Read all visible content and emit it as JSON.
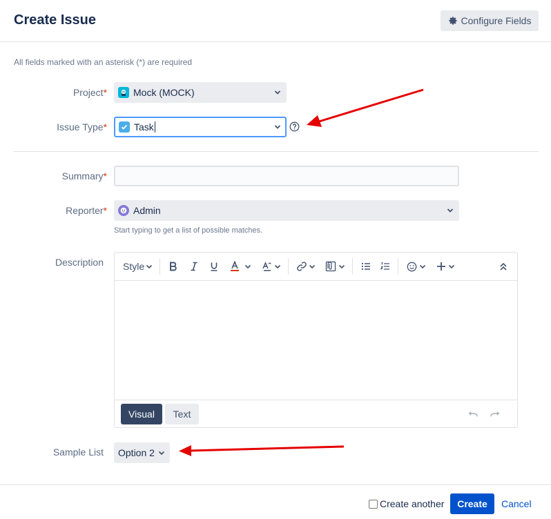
{
  "dialog": {
    "title": "Create Issue",
    "configure_label": "Configure Fields",
    "required_note": "All fields marked with an asterisk (*) are required"
  },
  "fields": {
    "project": {
      "label": "Project",
      "value": "Mock (MOCK)",
      "icon": "project-avatar-icon"
    },
    "issue_type": {
      "label": "Issue Type",
      "value": "Task",
      "icon": "task-checkbox-icon"
    },
    "summary": {
      "label": "Summary",
      "value": ""
    },
    "reporter": {
      "label": "Reporter",
      "value": "Admin",
      "hint": "Start typing to get a list of possible matches.",
      "icon": "user-avatar-icon"
    },
    "description": {
      "label": "Description"
    },
    "sample_list": {
      "label": "Sample List",
      "value": "Option 2"
    }
  },
  "required_marker": "*",
  "editor": {
    "style_label": "Style",
    "mode_visual": "Visual",
    "mode_text": "Text",
    "toolbar_icons": [
      "bold-icon",
      "italic-icon",
      "underline-icon",
      "text-color-icon",
      "text-format-icon",
      "link-icon",
      "attachment-icon",
      "bullet-list-icon",
      "numbered-list-icon",
      "emoji-icon",
      "insert-icon",
      "collapse-icon",
      "undo-icon",
      "redo-icon"
    ]
  },
  "footer": {
    "create_another_label": "Create another",
    "create_label": "Create",
    "cancel_label": "Cancel"
  },
  "colors": {
    "primary": "#0052cc",
    "required": "#de350b",
    "annotation_arrow": "#e50000",
    "focus_border": "#4c9aff"
  }
}
